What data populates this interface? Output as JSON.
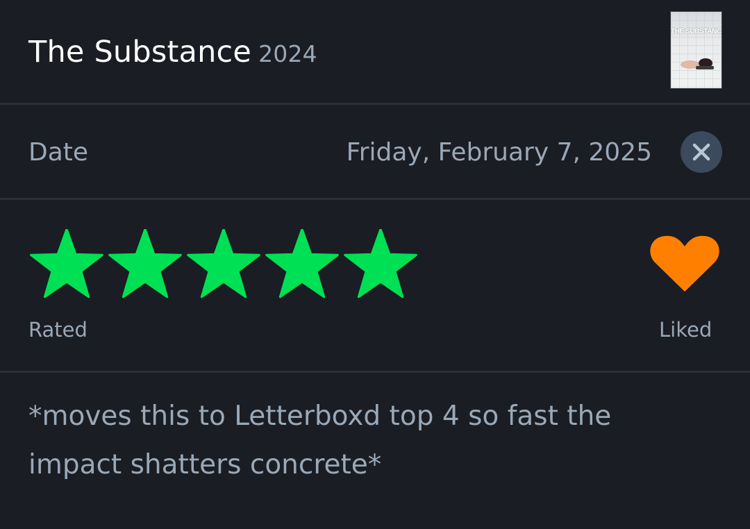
{
  "film": {
    "title": "The Substance",
    "year": "2024",
    "poster_text": "THE SUBSTANCE"
  },
  "date": {
    "label": "Date",
    "value": "Friday, February 7, 2025",
    "clear_icon": "close-icon"
  },
  "rating": {
    "stars": 5,
    "max_stars": 5,
    "label": "Rated",
    "star_color": "#00e054"
  },
  "like": {
    "liked": true,
    "label": "Liked",
    "heart_color": "#ff8000"
  },
  "review": {
    "text": "*moves this to Letterboxd top 4 so fast the impact shatters concrete*"
  }
}
